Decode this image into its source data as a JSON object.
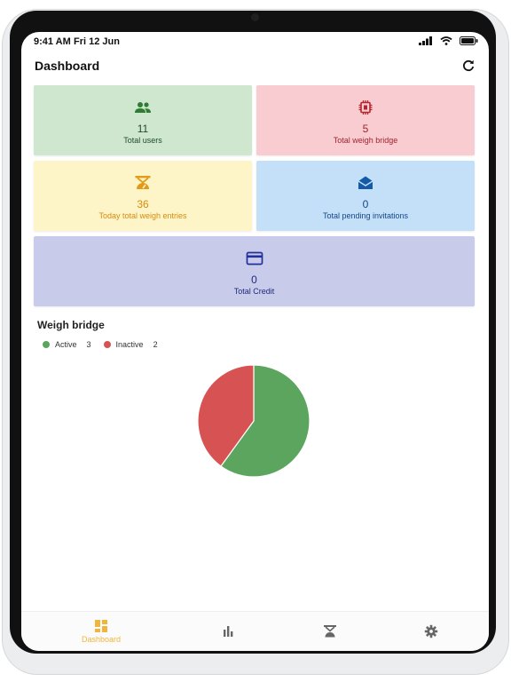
{
  "status_bar": {
    "time": "9:41 AM",
    "date": "Fri 12 Jun"
  },
  "header": {
    "title": "Dashboard",
    "refresh_icon": "refresh-icon"
  },
  "cards": [
    {
      "value": "11",
      "label": "Total users",
      "icon": "users-icon",
      "color": "#1f4a26",
      "bg": "#cfe7cf"
    },
    {
      "value": "5",
      "label": "Total weigh bridge",
      "icon": "chip-icon",
      "color": "#a1242d",
      "bg": "#f9ccd2"
    },
    {
      "value": "36",
      "label": "Today total weigh entries",
      "icon": "weigh-scale-icon",
      "color": "#d88b0f",
      "bg": "#fdf5c7"
    },
    {
      "value": "0",
      "label": "Total pending invitations",
      "icon": "envelope-icon",
      "color": "#14468a",
      "bg": "#c4e0f8"
    },
    {
      "value": "0",
      "label": "Total Credit",
      "icon": "credit-card-icon",
      "color": "#1e2b7a",
      "bg": "#c9cbea"
    }
  ],
  "weigh_bridge": {
    "title": "Weigh bridge",
    "legend": [
      {
        "label": "Active",
        "count": "3",
        "color": "#5ba55f"
      },
      {
        "label": "Inactive",
        "count": "2",
        "color": "#d75353"
      }
    ]
  },
  "chart_data": {
    "type": "pie",
    "title": "Weigh bridge",
    "categories": [
      "Active",
      "Inactive"
    ],
    "values": [
      3,
      2
    ],
    "colors": [
      "#5ba55f",
      "#d75353"
    ],
    "legend": "top-left"
  },
  "bottom_nav": [
    {
      "label": "Dashboard",
      "icon": "dashboard-icon",
      "active": true
    },
    {
      "label": "",
      "icon": "bar-chart-icon",
      "active": false
    },
    {
      "label": "",
      "icon": "weigh-scale-icon",
      "active": false
    },
    {
      "label": "",
      "icon": "gear-icon",
      "active": false
    }
  ]
}
